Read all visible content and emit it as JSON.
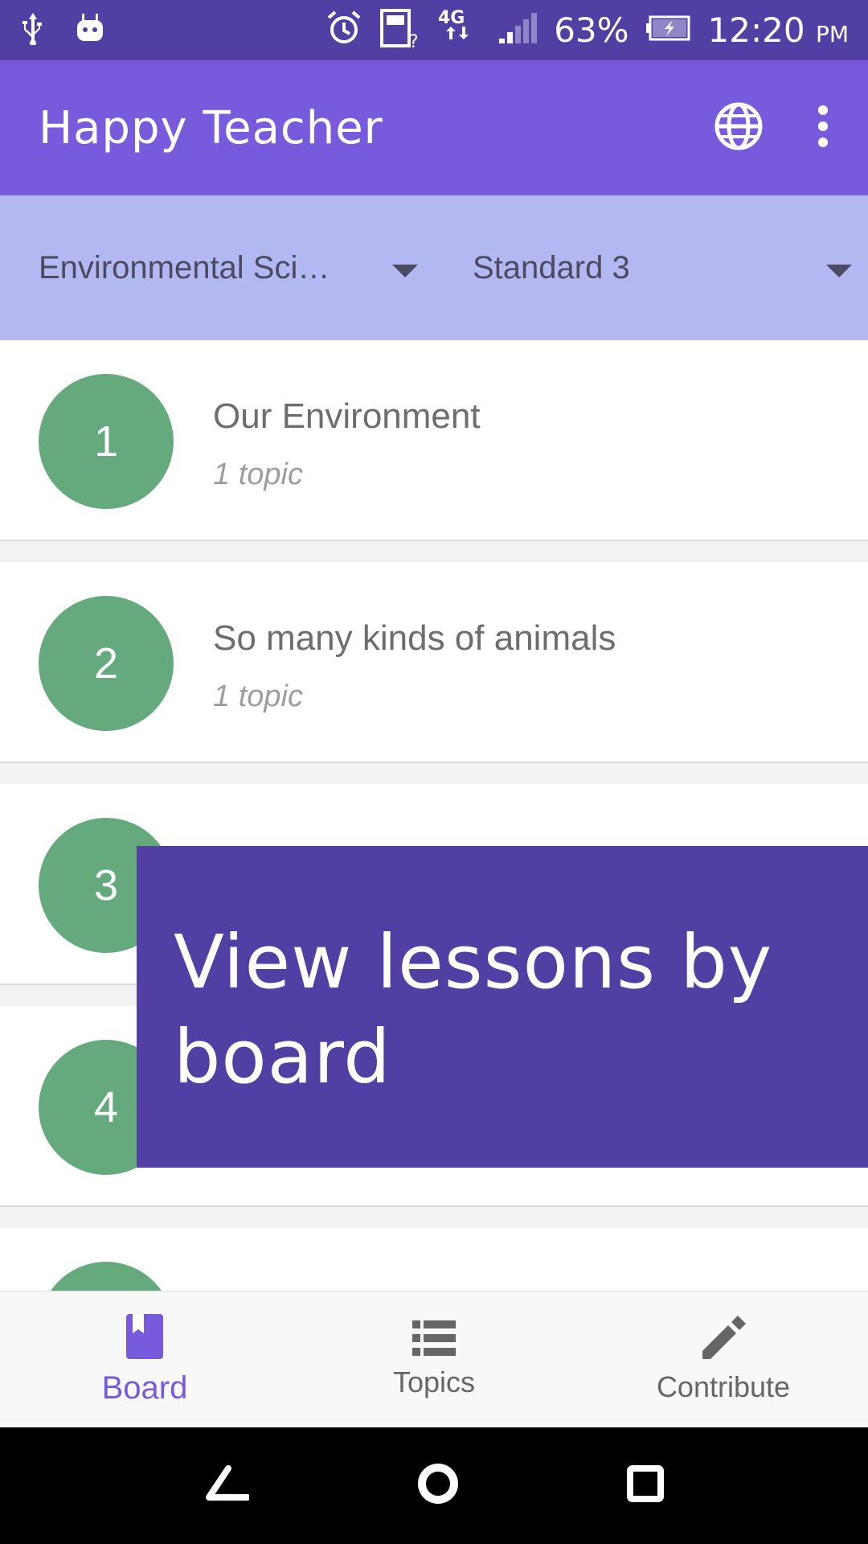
{
  "status_bar": {
    "network": "4G",
    "battery": "63%",
    "time": "12:20",
    "ampm": "PM"
  },
  "app_bar": {
    "title": "Happy Teacher"
  },
  "filters": {
    "subject": "Environmental Sci…",
    "standard": "Standard 3"
  },
  "lessons": [
    {
      "number": "1",
      "title": "Our Environment",
      "subtitle": "1 topic"
    },
    {
      "number": "2",
      "title": "So many kinds of animals",
      "subtitle": "1 topic"
    },
    {
      "number": "3"
    },
    {
      "number": "4"
    }
  ],
  "tooltip": {
    "text": "View lessons by board"
  },
  "bottom_nav": {
    "items": [
      {
        "label": "Board",
        "icon": "book-icon",
        "active": true
      },
      {
        "label": "Topics",
        "icon": "list-icon",
        "active": false
      },
      {
        "label": "Contribute",
        "icon": "pencil-icon",
        "active": false
      }
    ]
  },
  "colors": {
    "status_bar": "#523fa3",
    "app_bar": "#785add",
    "filter_bar": "#b3b7f2",
    "lesson_circle": "#64aa7d",
    "tooltip": "#523fa3",
    "accent": "#785add"
  }
}
